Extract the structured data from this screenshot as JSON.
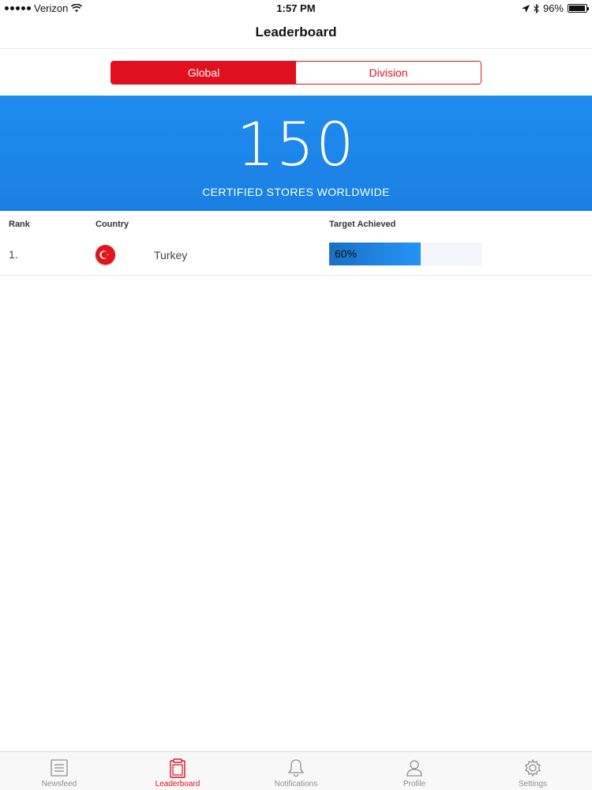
{
  "status_bar": {
    "carrier": "Verizon",
    "time": "1:57 PM",
    "battery": "96%",
    "battery_level": 0.96
  },
  "nav": {
    "title": "Leaderboard"
  },
  "segment": {
    "options": [
      "Global",
      "Division"
    ],
    "selected": "Global"
  },
  "hero": {
    "count": "150",
    "caption": "CERTIFIED STORES WORLDWIDE",
    "color": "#1f8cf0"
  },
  "table": {
    "headers": {
      "rank": "Rank",
      "country": "Country",
      "target": "Target Achieved"
    },
    "rows": [
      {
        "rank": "1.",
        "country": "Turkey",
        "flag_icon": "turkey-flag-icon",
        "target_label": "60%",
        "target_fraction": 0.6
      }
    ]
  },
  "tab_bar": {
    "tabs": [
      {
        "label": "Newsfeed",
        "icon": "newsfeed-icon"
      },
      {
        "label": "Leaderboard",
        "icon": "leaderboard-icon"
      },
      {
        "label": "Notifications",
        "icon": "bell-icon"
      },
      {
        "label": "Profile",
        "icon": "profile-icon"
      },
      {
        "label": "Settings",
        "icon": "gear-icon"
      }
    ],
    "active": "Leaderboard"
  },
  "colors": {
    "accent": "#e1101f",
    "hero_blue": "#1f8cf0"
  }
}
